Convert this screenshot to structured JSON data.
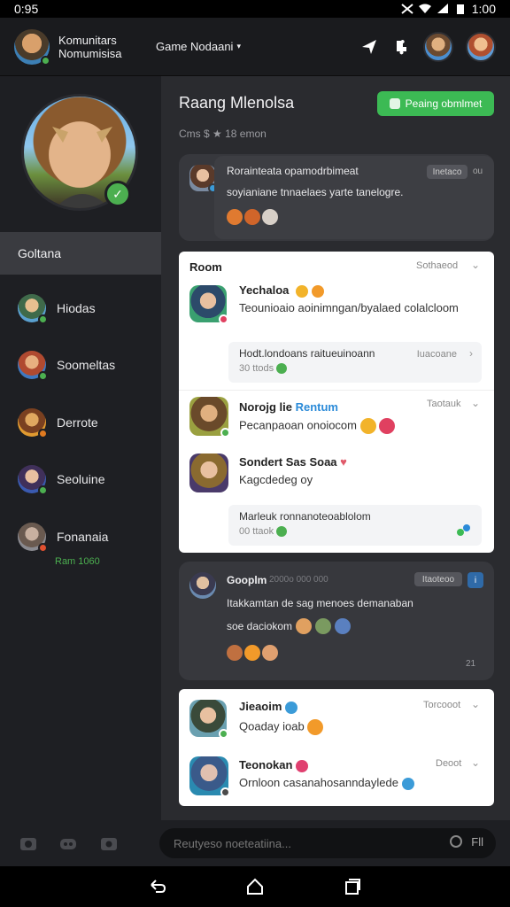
{
  "status": {
    "time_left": "0:95",
    "time_right": "1:00"
  },
  "header": {
    "title": "Komunitars Nomumisisa",
    "menu": "Game Nodaani",
    "menu_chevron": "▾"
  },
  "sidebar": {
    "active": "Goltana",
    "items": [
      {
        "label": "Hiodas"
      },
      {
        "label": "Soomeltas"
      },
      {
        "label": "Derrote"
      },
      {
        "label": "Seoluine"
      },
      {
        "label": "Fonanaia"
      }
    ],
    "sub_status": "Ram 1060"
  },
  "room": {
    "title": "Raang Mlenolsa",
    "button": "Peaing obmlmet",
    "sub": "Cms $ ★ 18 emon"
  },
  "post1": {
    "title": "Rorainteata opamodrbimeat",
    "tag": "Inetaco",
    "tag2": "ou",
    "body": "soyianiane tnnaelaes yarte tanelogre."
  },
  "card1": {
    "title": "Room",
    "meta": "Sothaeod",
    "m1_name": "Yechaloa",
    "m1_text": "Teounioaio aoinimngan/byalaed colalcloom",
    "sub1_text": "Hodt.londoans raitueuinoann",
    "sub1_meta": "30 ttods",
    "sub1_right": "Iuacoane",
    "m2_name": "Norojg lie",
    "m2_link": "Rentum",
    "m2_meta": "Taotauk",
    "m2_text": "Pecanpaoan onoiocom",
    "m3_name": "Sondert Sas Soaa",
    "m3_text": "Kagcdedeg oy",
    "sub2_text": "Marleuk ronnanoteoablolom",
    "sub2_meta": "00 ttaok"
  },
  "post2": {
    "name": "Gooplm",
    "meta": "2000o 000 000",
    "tag": "Itaoteoo",
    "body1": "Itakkamtan de sag menoes demanaban",
    "body2": "soe daciokom",
    "corner": "21"
  },
  "card2": {
    "m1_name": "Jieaoim",
    "m1_text": "Qoaday ioab",
    "m1_meta": "Torcooot",
    "m2_name": "Teonokan",
    "m2_text": "Ornloon casanahosanndaylede",
    "m2_meta": "Deoot"
  },
  "composer": {
    "placeholder": "Reutyeso noeteatiina...",
    "right": "Fll"
  },
  "colors": {
    "accent": "#3cba54",
    "bg": "#111214",
    "card": "#37383d"
  }
}
